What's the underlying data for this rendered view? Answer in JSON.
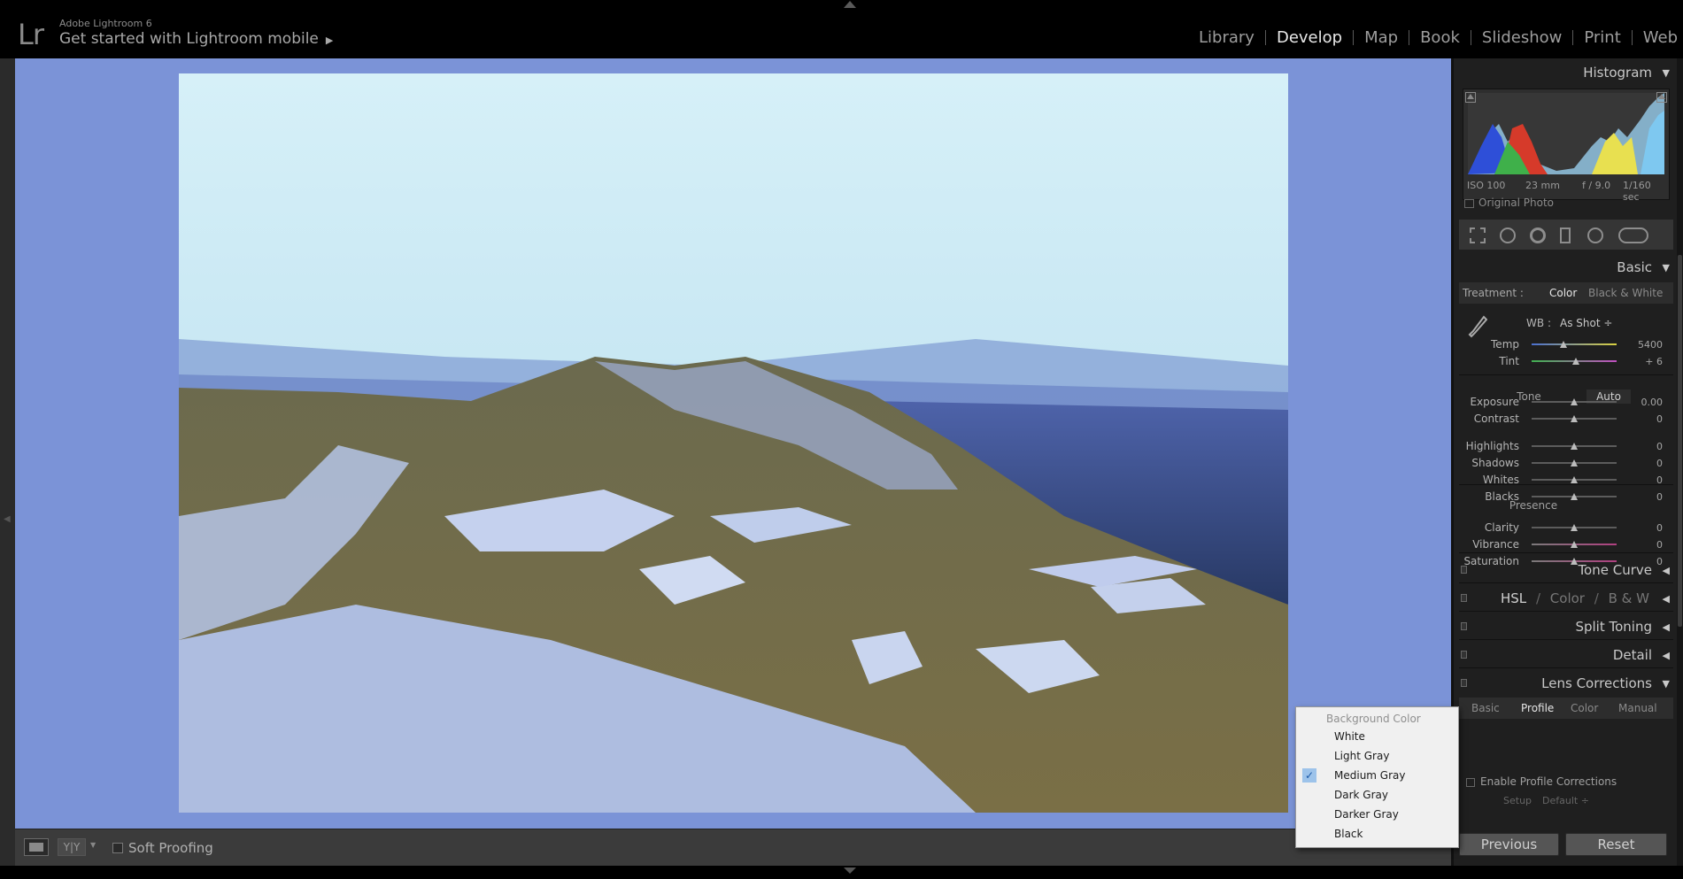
{
  "app": {
    "logo": "Lr",
    "name": "Adobe Lightroom 6",
    "mobile_link": "Get started with Lightroom mobile",
    "mobile_arrow": "▶"
  },
  "modules": [
    {
      "label": "Library",
      "active": false
    },
    {
      "label": "Develop",
      "active": true
    },
    {
      "label": "Map",
      "active": false
    },
    {
      "label": "Book",
      "active": false
    },
    {
      "label": "Slideshow",
      "active": false
    },
    {
      "label": "Print",
      "active": false
    },
    {
      "label": "Web",
      "active": false
    }
  ],
  "canvas": {
    "background_color": "#7b93d7"
  },
  "toolbar": {
    "before_after_label": "Y|Y",
    "soft_proofing_label": "Soft Proofing"
  },
  "histogram": {
    "title": "Histogram",
    "iso": "ISO 100",
    "focal": "23 mm",
    "aperture": "f / 9.0",
    "shutter": "1/160 sec",
    "original_photo_label": "Original Photo"
  },
  "basic": {
    "title": "Basic",
    "treatment_label": "Treatment :",
    "treatment_color": "Color",
    "treatment_bw": "Black & White",
    "wb_label": "WB :",
    "wb_value": "As Shot ÷",
    "tone_label": "Tone",
    "auto_label": "Auto",
    "presence_label": "Presence",
    "sliders": [
      {
        "label": "Temp",
        "value": "5400"
      },
      {
        "label": "Tint",
        "value": "+ 6"
      },
      {
        "label": "Exposure",
        "value": "0.00"
      },
      {
        "label": "Contrast",
        "value": "0"
      },
      {
        "label": "Highlights",
        "value": "0"
      },
      {
        "label": "Shadows",
        "value": "0"
      },
      {
        "label": "Whites",
        "value": "0"
      },
      {
        "label": "Blacks",
        "value": "0"
      },
      {
        "label": "Clarity",
        "value": "0"
      },
      {
        "label": "Vibrance",
        "value": "0"
      },
      {
        "label": "Saturation",
        "value": "0"
      }
    ]
  },
  "panels": {
    "tone_curve": "Tone Curve",
    "hsl": "HSL",
    "hsl_sep": "/",
    "color": "Color",
    "bw": "B & W",
    "split_toning": "Split Toning",
    "detail": "Detail",
    "lens_corrections": "Lens Corrections"
  },
  "lens": {
    "tabs": [
      {
        "label": "Basic",
        "active": false
      },
      {
        "label": "Profile",
        "active": true
      },
      {
        "label": "Color",
        "active": false
      },
      {
        "label": "Manual",
        "active": false
      }
    ],
    "enable_label": "Enable Profile Corrections",
    "setup_label": "Setup",
    "setup_value": "Default ÷"
  },
  "buttons": {
    "previous": "Previous",
    "reset": "Reset"
  },
  "context_menu": {
    "title": "Background Color",
    "items": [
      {
        "label": "White",
        "checked": false
      },
      {
        "label": "Light Gray",
        "checked": false
      },
      {
        "label": "Medium Gray",
        "checked": true
      },
      {
        "label": "Dark Gray",
        "checked": false
      },
      {
        "label": "Darker Gray",
        "checked": false
      },
      {
        "label": "Black",
        "checked": false
      }
    ],
    "checkmark": "✓"
  }
}
